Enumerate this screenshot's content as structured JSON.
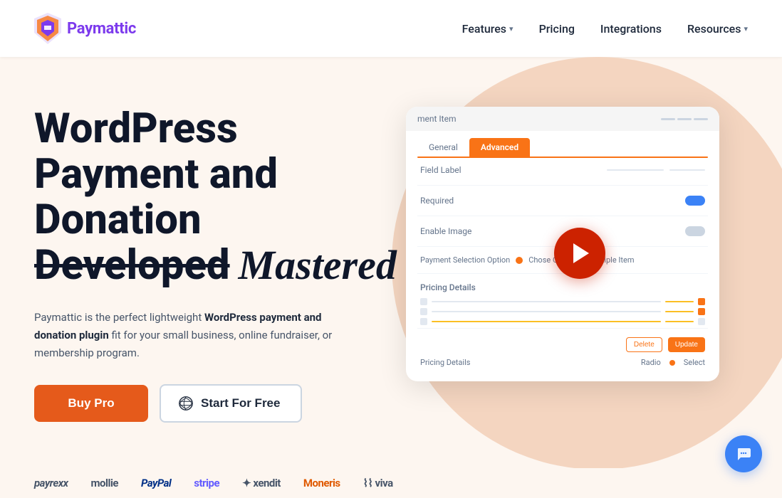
{
  "header": {
    "logo_text": "Paymattic",
    "nav_items": [
      {
        "label": "Features",
        "has_dropdown": true
      },
      {
        "label": "Pricing",
        "has_dropdown": false
      },
      {
        "label": "Integrations",
        "has_dropdown": false
      },
      {
        "label": "Resources",
        "has_dropdown": true
      }
    ]
  },
  "hero": {
    "heading_line1": "WordPress",
    "heading_line2": "Payment and",
    "heading_line3": "Donation",
    "heading_line4_strikethrough": "Developed",
    "heading_line4_cursive": "Mastered",
    "description_plain": "Paymattic is the perfect lightweight ",
    "description_bold": "WordPress payment and donation plugin",
    "description_plain2": " fit for your small business, online fundraiser, or membership program.",
    "btn_buy_pro": "Buy Pro",
    "btn_start_free": "Start For Free"
  },
  "screenshot": {
    "header_label": "ment Item",
    "tab_general": "General",
    "tab_advanced": "Advanced",
    "field_label_text": "Field Label",
    "required_text": "Required",
    "enable_image_text": "Enable Image",
    "payment_selection_text": "Payment Selection Option",
    "chose_text": "Chose One From Multiple Item",
    "pricing_details_text": "Pricing Details",
    "pricing_details_bottom": "Pricing Details",
    "radio_text": "Radio",
    "select_text": "Select",
    "btn_delete": "Delete",
    "btn_update": "Update"
  },
  "logos": [
    {
      "name": "payrexx",
      "label": "payrexx"
    },
    {
      "name": "mollie",
      "label": "mollie"
    },
    {
      "name": "paypal",
      "label": "PayPal"
    },
    {
      "name": "stripe",
      "label": "stripe"
    },
    {
      "name": "xendit",
      "label": "✦ xendit"
    },
    {
      "name": "moneris",
      "label": "Moneris"
    },
    {
      "name": "viva",
      "label": "⌇⌇ viva"
    }
  ],
  "colors": {
    "accent_orange": "#e55a1b",
    "accent_purple": "#7c3aed",
    "bg": "#fdf6f0",
    "circle_bg": "#f4d5c0"
  }
}
